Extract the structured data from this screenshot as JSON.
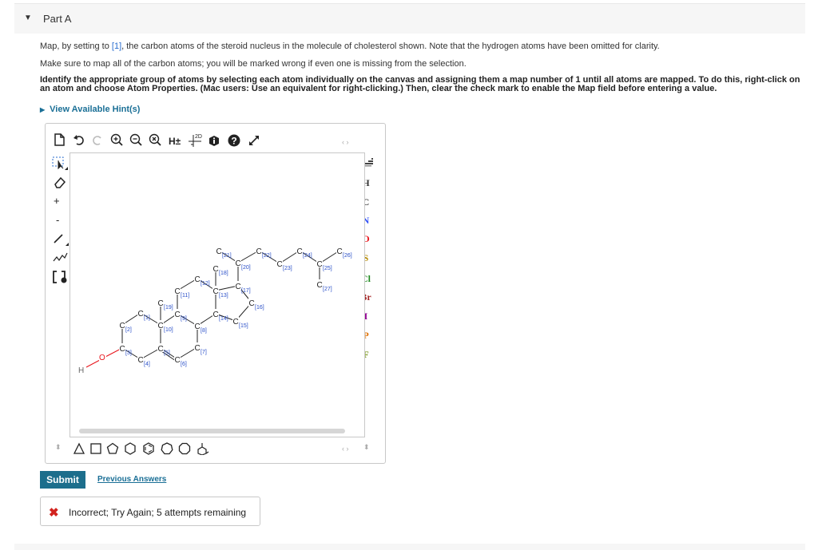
{
  "part": {
    "title": "Part A"
  },
  "instructions": {
    "p1_before": "Map, by setting to ",
    "p1_link": "[1]",
    "p1_after": ", the carbon atoms of the steroid nucleus in the molecule of cholesterol shown. Note that the hydrogen atoms have been omitted for clarity.",
    "p2": "Make sure to map all of the carbon atoms; you will be marked wrong if even one is missing from the selection.",
    "p3": "Identify the appropriate group of atoms by selecting each atom individually on the canvas and assigning them a map number of 1 until all atoms are mapped. To do this, right-click on an atom and choose Atom Properties. (Mac users: Use an equivalent for right-clicking.) Then, clear the check mark to enable the Map field before entering a value."
  },
  "hint": {
    "label": "View Available Hint(s)"
  },
  "toolbar": {
    "icons": [
      "new-document-icon",
      "undo-icon",
      "redo-icon",
      "zoom-in-icon",
      "zoom-out-icon",
      "zoom-reset-icon",
      "hydrogen-toggle-icon",
      "clean-2d-icon",
      "info-icon",
      "help-icon",
      "fullscreen-icon"
    ],
    "h_label": "H±",
    "clean_label": "2D"
  },
  "left_tools": {
    "plus": "+",
    "minus": "-"
  },
  "elements": [
    "H",
    "C",
    "N",
    "O",
    "S",
    "Cl",
    "Br",
    "I",
    "P",
    "F"
  ],
  "element_colors": {
    "H": "#333333",
    "C": "#333333",
    "N": "#3050f8",
    "O": "#e8131a",
    "S": "#b58a00",
    "Cl": "#1f8a1f",
    "Br": "#a62929",
    "I": "#940094",
    "P": "#e07000",
    "F": "#6a8a00"
  },
  "molecule": {
    "atom_symbol_C": "C",
    "atom_symbol_O": "O",
    "atom_symbol_H": "H",
    "map_labels": [
      "[1]",
      "[2]",
      "[3]",
      "[4]",
      "[5]",
      "[6]",
      "[7]",
      "[8]",
      "[9]",
      "[10]",
      "[11]",
      "[12]",
      "[13]",
      "[14]",
      "[15]",
      "[16]",
      "[17]",
      "[18]",
      "[19]",
      "[20]",
      "[21]",
      "[22]",
      "[23]",
      "[24]",
      "[25]",
      "[26]",
      "[27]"
    ]
  },
  "shape_tools": [
    "cyclopropane",
    "cyclobutane",
    "cyclopentane",
    "cyclohexane",
    "benzene",
    "cycloheptane",
    "cyclooctane",
    "templates"
  ],
  "actions": {
    "submit": "Submit",
    "previous": "Previous Answers"
  },
  "feedback": {
    "icon": "x-mark-icon",
    "message": "Incorrect; Try Again; 5 attempts remaining"
  }
}
